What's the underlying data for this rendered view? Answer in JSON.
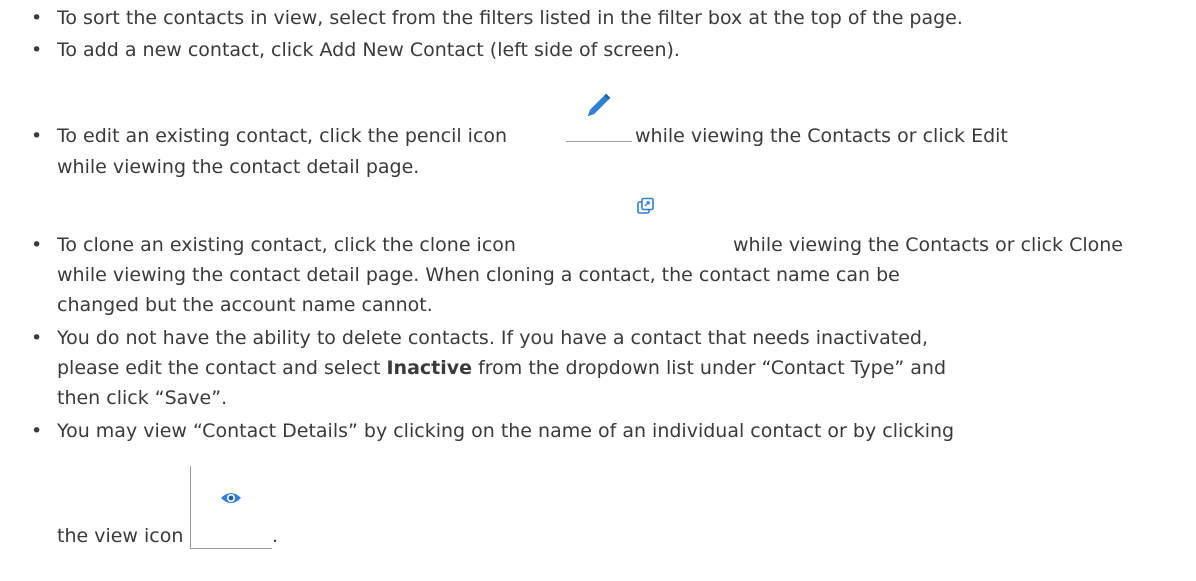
{
  "bullets": {
    "b1": {
      "text": "To sort the contacts in view, select from the filters listed in the filter box at the top of the page."
    },
    "b2": {
      "text": "To add a new contact, click Add New Contact (left side of screen)."
    },
    "b3": {
      "line1_before": "To edit an existing contact, click the pencil icon",
      "line1_after": "while viewing the Contacts or click Edit",
      "line2": "while viewing the contact detail page."
    },
    "b4": {
      "line1_before": "To clone an existing contact, click the clone icon",
      "line1_after": "while viewing the Contacts or click Clone",
      "line2": "while viewing the contact detail page. When cloning a contact, the contact name can be",
      "line3": "changed but the account name cannot."
    },
    "b5": {
      "line1": "You do not have the ability to delete contacts. If you have a contact that needs inactivated,",
      "line2_before": "please edit the contact and select",
      "line2_bold": "Inactive",
      "line2_after": "from the dropdown list under “Contact Type” and",
      "line3": "then click “Save”."
    },
    "b6": {
      "line1": "You may view “Contact Details” by clicking on the name of an individual contact or by clicking",
      "line2_before": "the view icon",
      "line2_after": "."
    }
  },
  "bullet_symbol": "•",
  "icons": {
    "pencil": "pencil-icon",
    "clone": "clone-icon",
    "view": "eye-icon",
    "accent_color": "#2e7fd6"
  }
}
